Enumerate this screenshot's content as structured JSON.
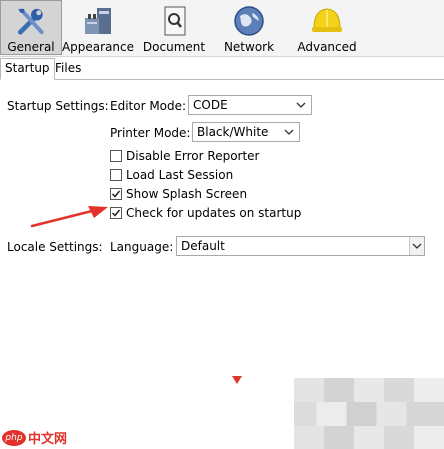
{
  "toolbar": {
    "items": [
      {
        "label": "General",
        "icon": "tools-icon"
      },
      {
        "label": "Appearance",
        "icon": "appearance-icon"
      },
      {
        "label": "Document",
        "icon": "document-icon"
      },
      {
        "label": "Network",
        "icon": "globe-icon"
      },
      {
        "label": "Advanced",
        "icon": "hardhat-icon"
      }
    ],
    "active": "General"
  },
  "tabs": [
    {
      "label": "Startup"
    },
    {
      "label": "Files"
    }
  ],
  "startup": {
    "section_label": "Startup Settings:",
    "editor_mode_label": "Editor Mode:",
    "editor_mode_value": "CODE",
    "printer_mode_label": "Printer Mode:",
    "printer_mode_value": "Black/White",
    "options": [
      {
        "label": "Disable Error Reporter",
        "checked": false
      },
      {
        "label": "Load Last Session",
        "checked": false
      },
      {
        "label": "Show Splash Screen",
        "checked": true
      },
      {
        "label": "Check for updates on startup",
        "checked": true
      }
    ]
  },
  "locale": {
    "section_label": "Locale Settings:",
    "language_label": "Language:",
    "language_value": "Default"
  },
  "watermark": {
    "badge": "php",
    "text": "中文网"
  },
  "colors": {
    "annotation": "#e2332b",
    "active_tab_bg": "#d4d4d4"
  }
}
